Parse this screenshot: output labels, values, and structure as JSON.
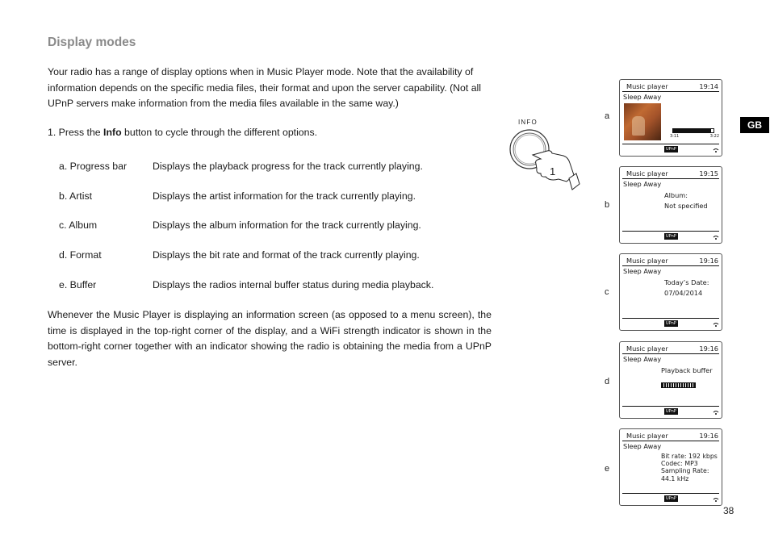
{
  "heading": "Display modes",
  "intro": "Your radio has a range of display options when in Music Player mode. Note that the availability of information depends on the specific media files, their format and upon the server capability. (Not all UPnP servers make information from the media files available in the same way.)",
  "step": {
    "prefix": "1. Press the ",
    "button": "Info",
    "suffix": " button to cycle through the different options."
  },
  "options": [
    {
      "label": "a. Progress bar",
      "description": "Displays the playback progress for the track currently playing."
    },
    {
      "label": "b. Artist",
      "description": "Displays the artist information for the track currently playing."
    },
    {
      "label": "c. Album",
      "description": "Displays the album information for the track currently playing."
    },
    {
      "label": "d. Format",
      "description": "Displays the bit rate and format of the track currently playing."
    },
    {
      "label": "e. Buffer",
      "description": "Displays the radios internal buffer status during media playback."
    }
  ],
  "outro": "Whenever the Music Player is displaying an information screen (as opposed to a menu screen), the time is displayed in the top-right corner of the display, and a WiFi strength indicator is shown in the bottom-right corner together with an indicator showing the radio is obtaining the media from a UPnP server.",
  "figure": {
    "button_label": "INFO",
    "finger_number": "1"
  },
  "screens": [
    {
      "letter": "a",
      "title": "Music player",
      "time": "19:14",
      "track": "Sleep Away",
      "progress": 0.94,
      "elapsed": "3:11",
      "total": "3:22",
      "badge": "UPnP"
    },
    {
      "letter": "b",
      "title": "Music player",
      "time": "19:15",
      "track": "Sleep Away",
      "info_line1": "Album:",
      "info_line2": "Not specified",
      "badge": "UPnP"
    },
    {
      "letter": "c",
      "title": "Music player",
      "time": "19:16",
      "track": "Sleep Away",
      "info_line1": "Today’s Date:",
      "info_line2": "07/04/2014",
      "badge": "UPnP"
    },
    {
      "letter": "d",
      "title": "Music player",
      "time": "19:16",
      "track": "Sleep Away",
      "buffer_label": "Playback buffer",
      "badge": "UPnP"
    },
    {
      "letter": "e",
      "title": "Music player",
      "time": "19:16",
      "track": "Sleep Away",
      "info_lines": [
        "Bit rate: 192 kbps",
        "Codec: MP3",
        "Sampling Rate:",
        "44.1 kHz"
      ],
      "badge": "UPnP"
    }
  ],
  "language_tab": "GB",
  "page_number": "38"
}
